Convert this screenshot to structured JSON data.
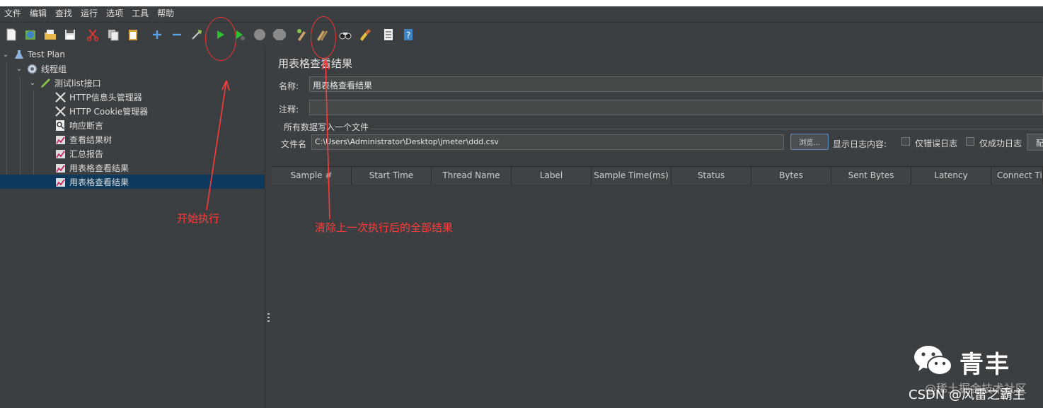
{
  "menu": [
    "文件",
    "编辑",
    "查找",
    "运行",
    "选项",
    "工具",
    "帮助"
  ],
  "toolbar_icons": [
    "new-icon",
    "templates-icon",
    "open-icon",
    "save-icon",
    "cut-icon",
    "copy-icon",
    "paste-icon",
    "expand-icon",
    "collapse-icon",
    "toggle-icon",
    "start-icon",
    "start-no-pause-icon",
    "stop-icon",
    "shutdown-icon",
    "clear-icon",
    "clear-all-icon",
    "search-icon",
    "reset-search-icon",
    "function-helper-icon",
    "help-icon"
  ],
  "tree": {
    "items": [
      {
        "label": "Test Plan",
        "icon": "test-plan-icon"
      },
      {
        "label": "线程组",
        "icon": "gear-icon"
      },
      {
        "label": "测试list接口",
        "icon": "pencil-icon"
      },
      {
        "label": "HTTP信息头管理器",
        "icon": "wrench-icon"
      },
      {
        "label": "HTTP Cookie管理器",
        "icon": "wrench-icon"
      },
      {
        "label": "响应断言",
        "icon": "magnifier-icon"
      },
      {
        "label": "查看结果树",
        "icon": "listener-icon"
      },
      {
        "label": "汇总报告",
        "icon": "listener-icon"
      },
      {
        "label": "用表格查看结果",
        "icon": "listener-icon"
      },
      {
        "label": "用表格查看结果",
        "icon": "listener-icon"
      }
    ]
  },
  "panel": {
    "title": "用表格查看结果",
    "name_label": "名称:",
    "name_value": "用表格查看结果",
    "comment_label": "注释:",
    "comment_value": "",
    "file_group_label": "所有数据写入一个文件",
    "filename_label": "文件名",
    "filename_value": "C:\\Users\\Administrator\\Desktop\\jmeter\\ddd.csv",
    "browse_label": "浏览...",
    "log_content_label": "显示日志内容:",
    "errors_only_label": "仅错误日志",
    "success_only_label": "仅成功日志",
    "config_label": "配置"
  },
  "table": {
    "columns": [
      "Sample #",
      "Start Time",
      "Thread Name",
      "Label",
      "Sample Time(ms)",
      "Status",
      "Bytes",
      "Sent Bytes",
      "Latency",
      "Connect Time(ms)"
    ],
    "rows": []
  },
  "annotations": {
    "start": "开始执行",
    "clear_all": "清除上一次执行后的全部结果",
    "color": "#ff3b3b"
  },
  "watermark": {
    "name": "青丰",
    "line1": "@稀土掘金技术社区",
    "line2": "CSDN @风雷之霸主"
  },
  "colors": {
    "background": "#3c3f41",
    "selection": "#0d3a5c",
    "start_green": "#2fbf2f"
  }
}
